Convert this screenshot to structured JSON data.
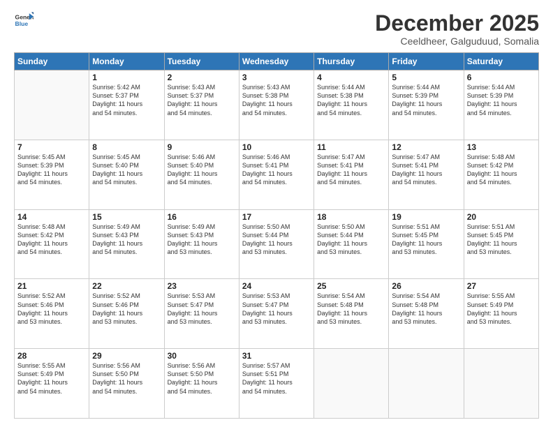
{
  "logo": {
    "line1": "General",
    "line2": "Blue"
  },
  "title": "December 2025",
  "subtitle": "Ceeldheer, Galguduud, Somalia",
  "weekdays": [
    "Sunday",
    "Monday",
    "Tuesday",
    "Wednesday",
    "Thursday",
    "Friday",
    "Saturday"
  ],
  "weeks": [
    [
      {
        "day": "",
        "info": ""
      },
      {
        "day": "1",
        "info": "Sunrise: 5:42 AM\nSunset: 5:37 PM\nDaylight: 11 hours\nand 54 minutes."
      },
      {
        "day": "2",
        "info": "Sunrise: 5:43 AM\nSunset: 5:37 PM\nDaylight: 11 hours\nand 54 minutes."
      },
      {
        "day": "3",
        "info": "Sunrise: 5:43 AM\nSunset: 5:38 PM\nDaylight: 11 hours\nand 54 minutes."
      },
      {
        "day": "4",
        "info": "Sunrise: 5:44 AM\nSunset: 5:38 PM\nDaylight: 11 hours\nand 54 minutes."
      },
      {
        "day": "5",
        "info": "Sunrise: 5:44 AM\nSunset: 5:39 PM\nDaylight: 11 hours\nand 54 minutes."
      },
      {
        "day": "6",
        "info": "Sunrise: 5:44 AM\nSunset: 5:39 PM\nDaylight: 11 hours\nand 54 minutes."
      }
    ],
    [
      {
        "day": "7",
        "info": "Sunrise: 5:45 AM\nSunset: 5:39 PM\nDaylight: 11 hours\nand 54 minutes."
      },
      {
        "day": "8",
        "info": "Sunrise: 5:45 AM\nSunset: 5:40 PM\nDaylight: 11 hours\nand 54 minutes."
      },
      {
        "day": "9",
        "info": "Sunrise: 5:46 AM\nSunset: 5:40 PM\nDaylight: 11 hours\nand 54 minutes."
      },
      {
        "day": "10",
        "info": "Sunrise: 5:46 AM\nSunset: 5:41 PM\nDaylight: 11 hours\nand 54 minutes."
      },
      {
        "day": "11",
        "info": "Sunrise: 5:47 AM\nSunset: 5:41 PM\nDaylight: 11 hours\nand 54 minutes."
      },
      {
        "day": "12",
        "info": "Sunrise: 5:47 AM\nSunset: 5:41 PM\nDaylight: 11 hours\nand 54 minutes."
      },
      {
        "day": "13",
        "info": "Sunrise: 5:48 AM\nSunset: 5:42 PM\nDaylight: 11 hours\nand 54 minutes."
      }
    ],
    [
      {
        "day": "14",
        "info": "Sunrise: 5:48 AM\nSunset: 5:42 PM\nDaylight: 11 hours\nand 54 minutes."
      },
      {
        "day": "15",
        "info": "Sunrise: 5:49 AM\nSunset: 5:43 PM\nDaylight: 11 hours\nand 54 minutes."
      },
      {
        "day": "16",
        "info": "Sunrise: 5:49 AM\nSunset: 5:43 PM\nDaylight: 11 hours\nand 53 minutes."
      },
      {
        "day": "17",
        "info": "Sunrise: 5:50 AM\nSunset: 5:44 PM\nDaylight: 11 hours\nand 53 minutes."
      },
      {
        "day": "18",
        "info": "Sunrise: 5:50 AM\nSunset: 5:44 PM\nDaylight: 11 hours\nand 53 minutes."
      },
      {
        "day": "19",
        "info": "Sunrise: 5:51 AM\nSunset: 5:45 PM\nDaylight: 11 hours\nand 53 minutes."
      },
      {
        "day": "20",
        "info": "Sunrise: 5:51 AM\nSunset: 5:45 PM\nDaylight: 11 hours\nand 53 minutes."
      }
    ],
    [
      {
        "day": "21",
        "info": "Sunrise: 5:52 AM\nSunset: 5:46 PM\nDaylight: 11 hours\nand 53 minutes."
      },
      {
        "day": "22",
        "info": "Sunrise: 5:52 AM\nSunset: 5:46 PM\nDaylight: 11 hours\nand 53 minutes."
      },
      {
        "day": "23",
        "info": "Sunrise: 5:53 AM\nSunset: 5:47 PM\nDaylight: 11 hours\nand 53 minutes."
      },
      {
        "day": "24",
        "info": "Sunrise: 5:53 AM\nSunset: 5:47 PM\nDaylight: 11 hours\nand 53 minutes."
      },
      {
        "day": "25",
        "info": "Sunrise: 5:54 AM\nSunset: 5:48 PM\nDaylight: 11 hours\nand 53 minutes."
      },
      {
        "day": "26",
        "info": "Sunrise: 5:54 AM\nSunset: 5:48 PM\nDaylight: 11 hours\nand 53 minutes."
      },
      {
        "day": "27",
        "info": "Sunrise: 5:55 AM\nSunset: 5:49 PM\nDaylight: 11 hours\nand 53 minutes."
      }
    ],
    [
      {
        "day": "28",
        "info": "Sunrise: 5:55 AM\nSunset: 5:49 PM\nDaylight: 11 hours\nand 54 minutes."
      },
      {
        "day": "29",
        "info": "Sunrise: 5:56 AM\nSunset: 5:50 PM\nDaylight: 11 hours\nand 54 minutes."
      },
      {
        "day": "30",
        "info": "Sunrise: 5:56 AM\nSunset: 5:50 PM\nDaylight: 11 hours\nand 54 minutes."
      },
      {
        "day": "31",
        "info": "Sunrise: 5:57 AM\nSunset: 5:51 PM\nDaylight: 11 hours\nand 54 minutes."
      },
      {
        "day": "",
        "info": ""
      },
      {
        "day": "",
        "info": ""
      },
      {
        "day": "",
        "info": ""
      }
    ]
  ]
}
